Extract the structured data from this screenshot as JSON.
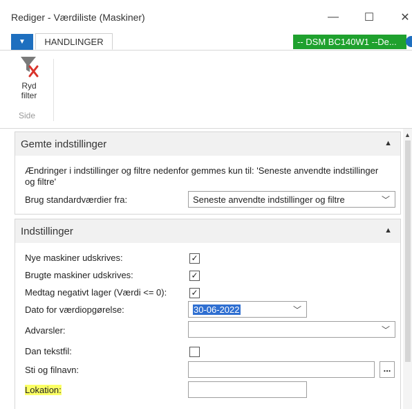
{
  "window": {
    "title": "Rediger - Værdiliste (Maskiner)",
    "minimize": "—",
    "maximize": "☐",
    "close": "✕"
  },
  "ribbon": {
    "file_menu_glyph": "▼",
    "tab": "HANDLINGER",
    "company": "-- DSM BC140W1 --De...",
    "clear_filter_label": "Ryd filter",
    "group_label": "Side",
    "clear_filter_icon": "funnel-x-icon"
  },
  "saved_settings": {
    "header": "Gemte indstillinger",
    "collapse_glyph": "▲",
    "info": "Ændringer i indstillinger og filtre nedenfor gemmes kun til: 'Seneste anvendte indstillinger og filtre'",
    "use_defaults_label": "Brug standardværdier fra:",
    "use_defaults_value": "Seneste anvendte indstillinger og filtre"
  },
  "options": {
    "header": "Indstillinger",
    "collapse_glyph": "▲",
    "new_machines_label": "Nye maskiner udskrives:",
    "new_machines_checked": true,
    "used_machines_label": "Brugte maskiner udskrives:",
    "used_machines_checked": true,
    "negative_stock_label": "Medtag negativt lager (Værdi <= 0):",
    "negative_stock_checked": true,
    "valuation_date_label": "Dato for værdiopgørelse:",
    "valuation_date_value": "30-06-2022",
    "warnings_label": "Advarsler:",
    "warnings_value": "",
    "text_file_label": "Dan tekstfil:",
    "text_file_checked": false,
    "path_label": "Sti og filnavn:",
    "path_value": "",
    "browse_label": "...",
    "location_label": "Lokation:",
    "location_value": ""
  },
  "colors": {
    "accent": "#1e6fbf",
    "company_badge": "#1fa12e",
    "date_selection": "#2f6fd1",
    "highlight": "#fbff64"
  }
}
